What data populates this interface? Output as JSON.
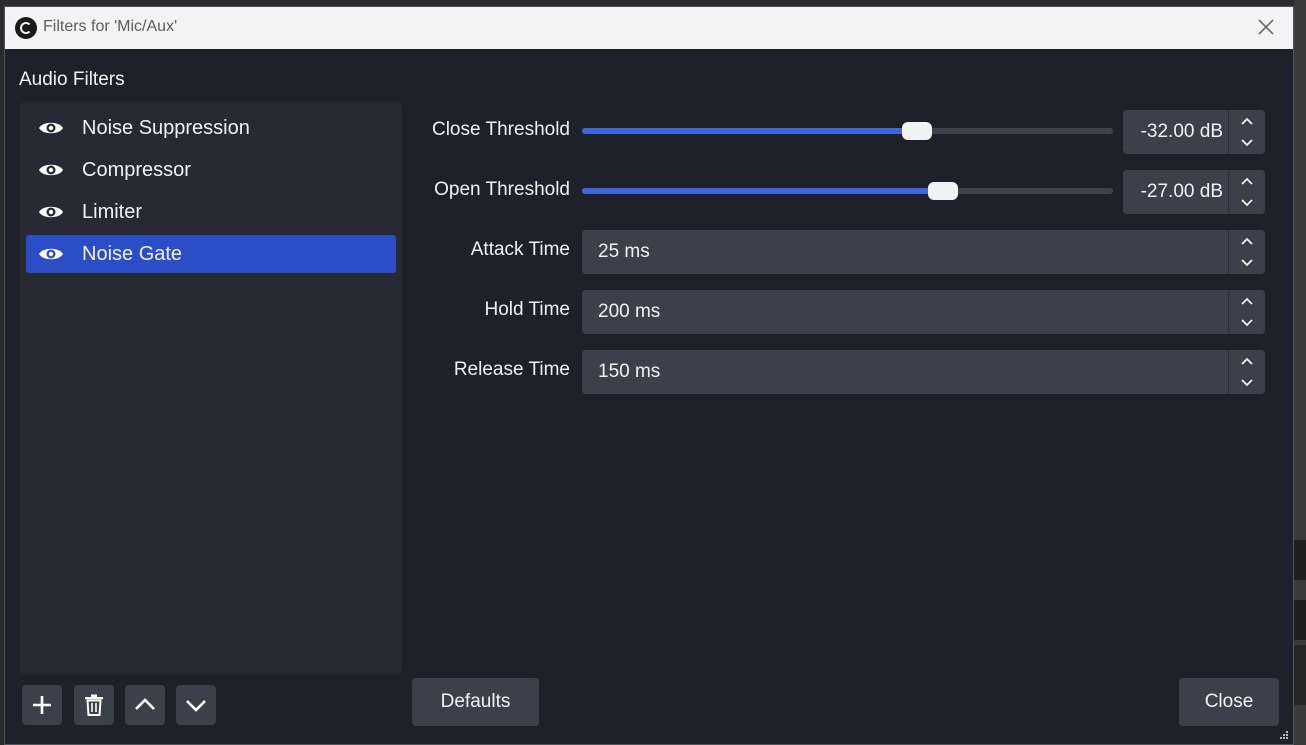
{
  "window": {
    "title": "Filters for 'Mic/Aux'",
    "icons": {
      "app": "obs-logo-icon",
      "close": "close-icon"
    }
  },
  "filters_section": {
    "label": "Audio Filters",
    "items": [
      {
        "label": "Noise Suppression",
        "icon": "eye-icon",
        "visible": true,
        "selected": false
      },
      {
        "label": "Compressor",
        "icon": "eye-icon",
        "visible": true,
        "selected": false
      },
      {
        "label": "Limiter",
        "icon": "eye-icon",
        "visible": true,
        "selected": false
      },
      {
        "label": "Noise Gate",
        "icon": "eye-icon",
        "visible": true,
        "selected": true
      }
    ],
    "toolbar_icons": [
      "plus-icon",
      "trash-icon",
      "chevron-up-icon",
      "chevron-down-icon"
    ]
  },
  "properties": {
    "close_threshold": {
      "label": "Close Threshold",
      "value": "-32.00 dB",
      "slider_fraction": 0.63
    },
    "open_threshold": {
      "label": "Open Threshold",
      "value": "-27.00 dB",
      "slider_fraction": 0.68
    },
    "attack_time": {
      "label": "Attack Time",
      "value": "25 ms"
    },
    "hold_time": {
      "label": "Hold Time",
      "value": "200 ms"
    },
    "release_time": {
      "label": "Release Time",
      "value": "150 ms"
    }
  },
  "buttons": {
    "defaults": "Defaults",
    "close": "Close"
  },
  "colors": {
    "accent": "#2b4dc6",
    "slider_fill": "#3d66d6",
    "panel_bg": "#1f212a",
    "list_bg": "#272a33",
    "control_bg": "#3c404b"
  }
}
